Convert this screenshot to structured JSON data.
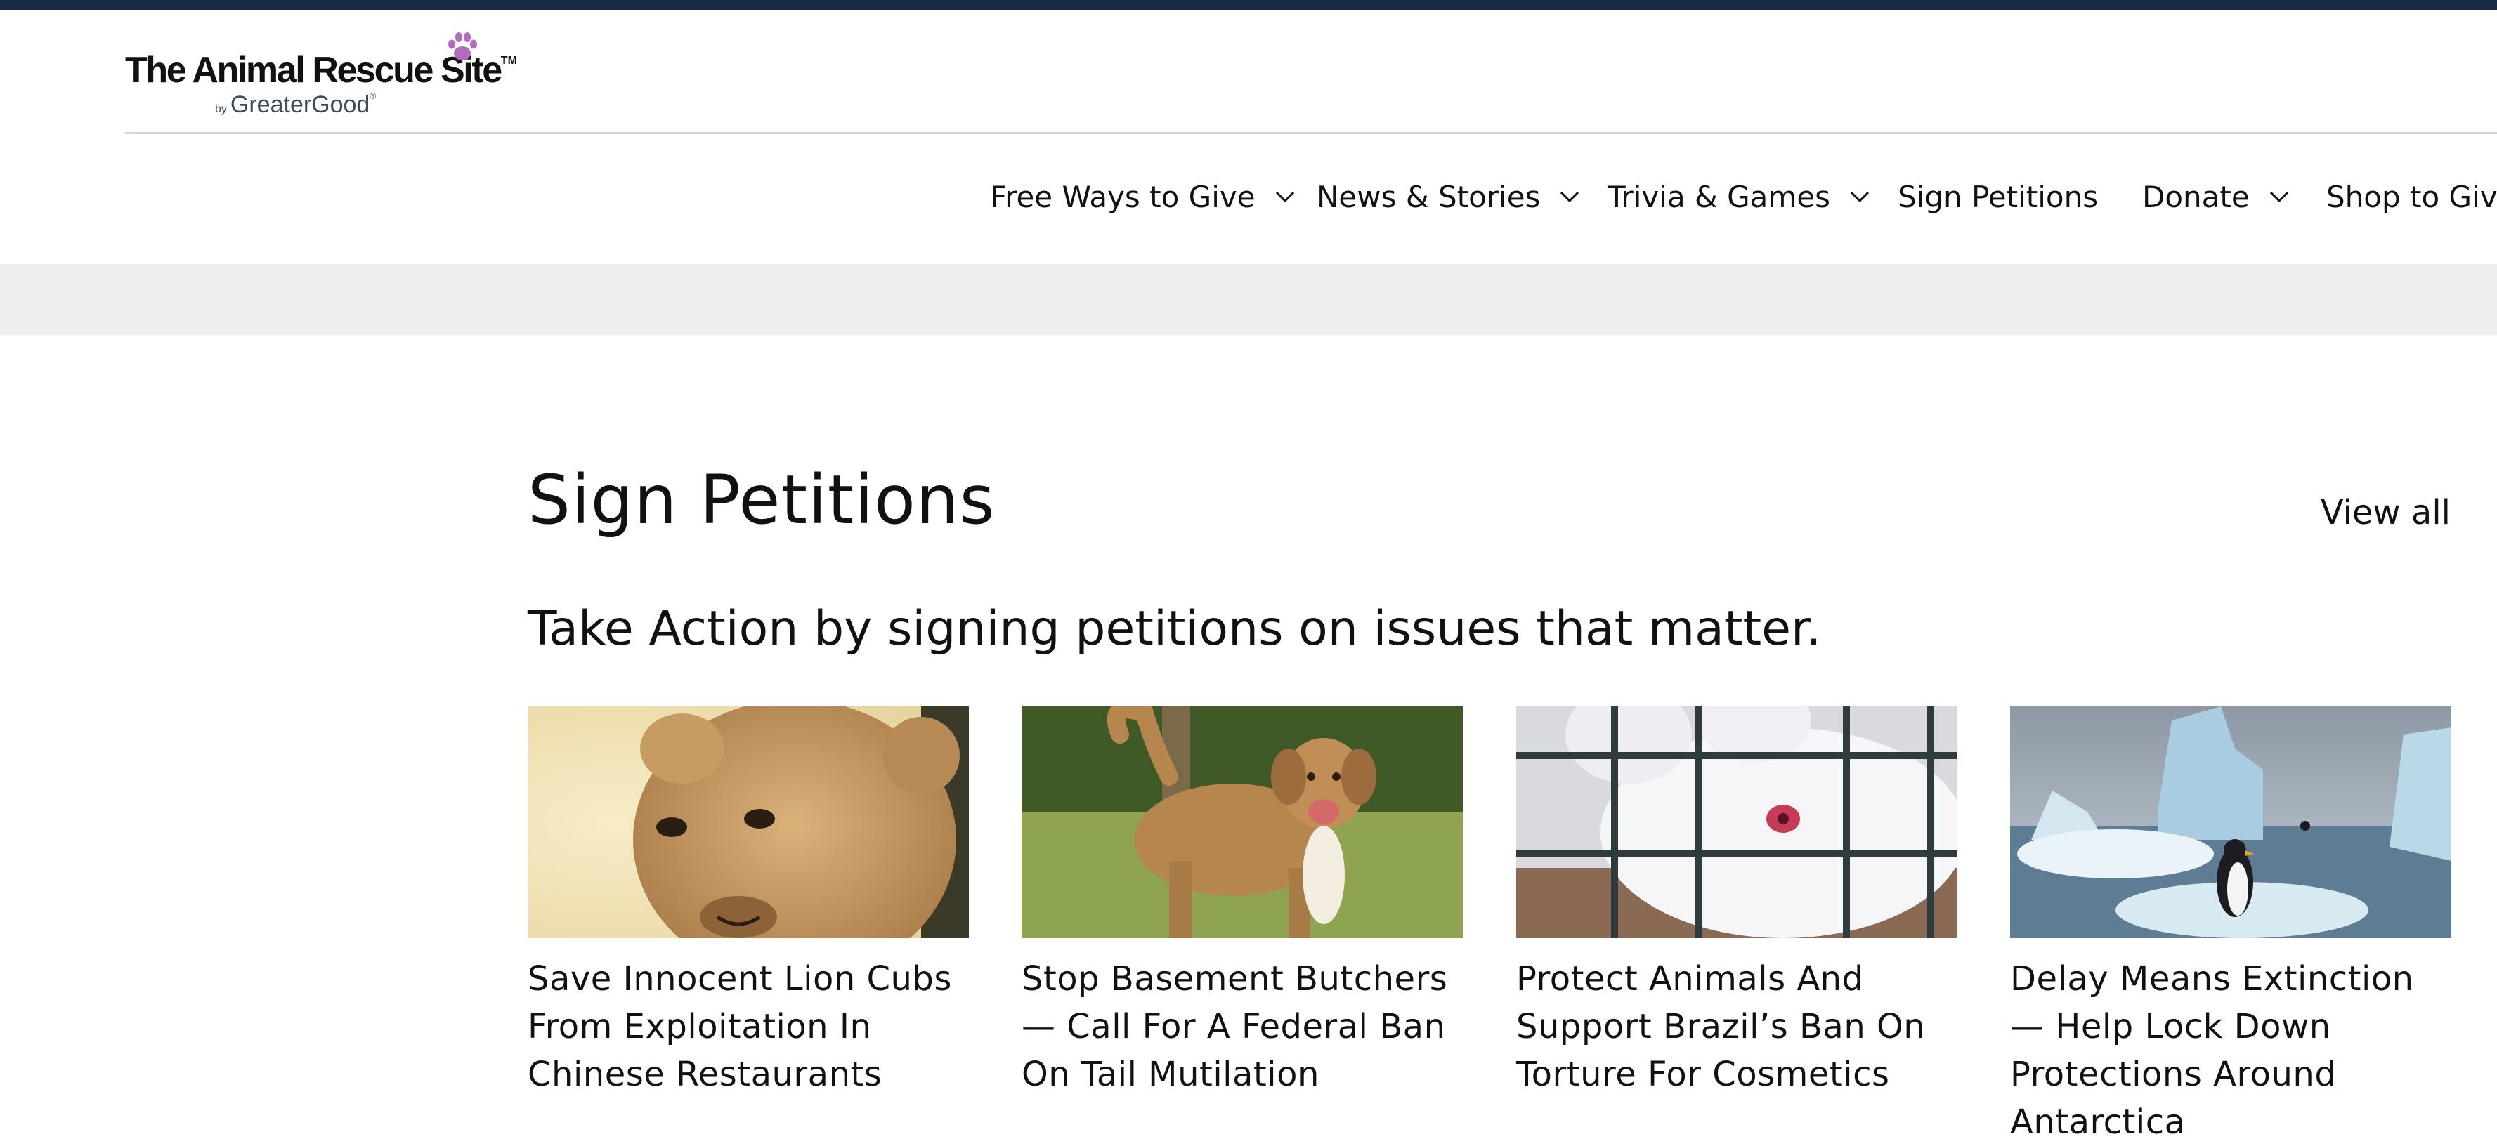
{
  "header": {
    "logo": {
      "name": "The Animal Rescue Site",
      "trademark": "TM",
      "by": "by",
      "brand": "GreaterGood",
      "registered": "®"
    },
    "colors": {
      "top_stripe": "#192a47",
      "paw": "#b36bbd",
      "grey_band": "#efefef"
    }
  },
  "nav": {
    "items": [
      {
        "label": "Free Ways to Give",
        "has_dropdown": true,
        "icon": "chevron-down-icon"
      },
      {
        "label": "News & Stories",
        "has_dropdown": true,
        "icon": "chevron-down-icon"
      },
      {
        "label": "Trivia & Games",
        "has_dropdown": true,
        "icon": "chevron-down-icon"
      },
      {
        "label": "Sign Petitions",
        "has_dropdown": false
      },
      {
        "label": "Donate",
        "has_dropdown": true,
        "icon": "chevron-down-icon"
      },
      {
        "label": "Shop to Give",
        "has_dropdown": false
      }
    ]
  },
  "section": {
    "title": "Sign Petitions",
    "view_all": "View all",
    "subtitle": "Take Action by signing petitions on issues that matter.",
    "cards": [
      {
        "title": "Save Innocent Lion Cubs From Exploitation In Chinese Restaurants",
        "image": "lion-cub-photo"
      },
      {
        "title": "Stop Basement Butchers— Call For A Federal Ban On Tail Mutilation",
        "image": "dog-photo"
      },
      {
        "title": "Protect Animals And Support Brazil’s Ban On Torture For Cosmetics",
        "image": "rabbit-in-cage-photo"
      },
      {
        "title": "Delay Means Extinction — Help Lock Down Protections Around Antarctica",
        "image": "penguin-on-ice-photo"
      }
    ]
  }
}
